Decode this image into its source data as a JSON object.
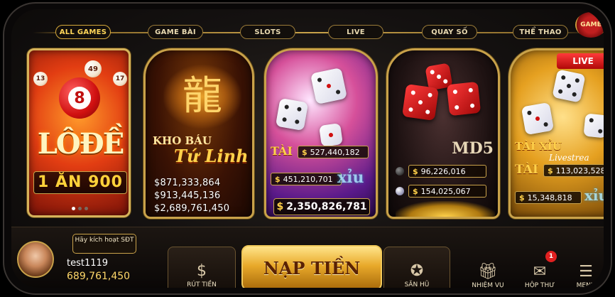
{
  "tabs": [
    {
      "label": "ALL GAMES"
    },
    {
      "label": "GAME BÀI"
    },
    {
      "label": "SLOTS"
    },
    {
      "label": "LIVE"
    },
    {
      "label": "QUAY SỐ"
    },
    {
      "label": "THỂ THAO"
    }
  ],
  "corner_badge": "GAME",
  "lode": {
    "balls": [
      "49",
      "17",
      "13"
    ],
    "big_ball": "8",
    "title": "LÔĐỀ",
    "prize": "1 ĂN 900"
  },
  "tulinh": {
    "line1": "KHO BÁU",
    "line2": "Tứ Linh",
    "jackpots": [
      "$871,333,864",
      "$913,445,136",
      "$2,689,761,450"
    ]
  },
  "taixiu": {
    "tai": "TÀI",
    "xiu": "xỉu",
    "jackpots": [
      "527,440,182",
      "451,210,701"
    ],
    "total": "2,350,826,781"
  },
  "md5": {
    "label": "MD5",
    "jackpots": [
      "96,226,016",
      "154,025,067"
    ]
  },
  "live_card": {
    "badge": "LIVE",
    "tai_xiu": "TÀI XỈU",
    "livestream": "Livestrea",
    "tai": "TÀI",
    "xiu": "xỉu",
    "jackpots": [
      "113,023,528",
      "15,348,818"
    ]
  },
  "currency": "$",
  "user": {
    "activate": "Hãy kích hoạt SĐT",
    "name": "test1119",
    "balance": "689,761,450"
  },
  "bottom": {
    "rut_tien": "RÚT TIỀN",
    "nap_tien": "NẠP TIỀN",
    "san_hu": "SĂN HŨ",
    "nhiem_vu": "NHIỆM VỤ",
    "hop_thu": "HỘP THƯ",
    "hop_thu_count": "1",
    "menu": "MENU"
  },
  "colors": {
    "gold": "#c9a24a",
    "accent": "#ffd14a",
    "live_red": "#e02020"
  }
}
